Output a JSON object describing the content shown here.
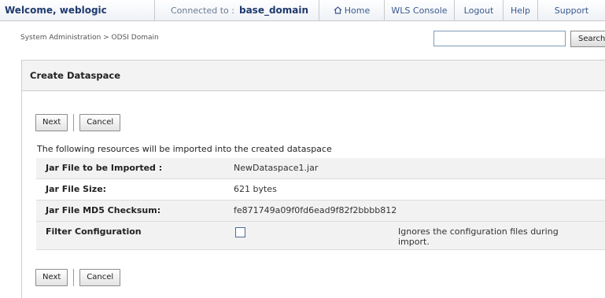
{
  "header": {
    "welcome": "Welcome, weblogic",
    "connected_label": "Connected to :",
    "domain": "base_domain",
    "nav": [
      "Home",
      "WLS Console",
      "Logout",
      "Help",
      "Support"
    ]
  },
  "breadcrumb": "System Administration > ODSI Domain",
  "search": {
    "value": "",
    "button": "Search"
  },
  "panel": {
    "title": "Create Dataspace",
    "buttons": {
      "next": "Next",
      "cancel": "Cancel"
    },
    "intro": "The following resources will be imported into the created dataspace",
    "rows": [
      {
        "label": "Jar File to be Imported :",
        "value": "NewDataspace1.jar"
      },
      {
        "label": "Jar File Size:",
        "value": "621 bytes"
      },
      {
        "label": "Jar File MD5 Checksum:",
        "value": "fe871749a09f0fd6ead9f82f2bbbb812"
      },
      {
        "label": "Filter Configuration",
        "checked": false,
        "description": "Ignores the configuration files during import."
      }
    ]
  }
}
